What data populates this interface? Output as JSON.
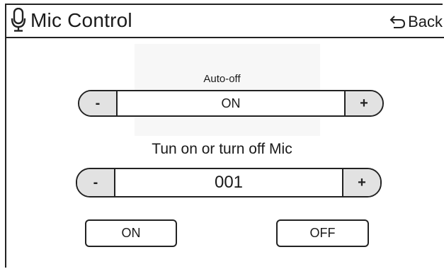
{
  "header": {
    "title": "Mic Control",
    "back_label": "Back",
    "title_icon": "microphone-icon",
    "back_icon": "back-arrow-icon"
  },
  "auto_off": {
    "label": "Auto-off",
    "value": "ON",
    "decrement_label": "-",
    "increment_label": "+"
  },
  "mic_channel": {
    "label": "Tun on or turn off Mic",
    "value": "001",
    "decrement_label": "-",
    "increment_label": "+"
  },
  "actions": {
    "on_label": "ON",
    "off_label": "OFF"
  }
}
